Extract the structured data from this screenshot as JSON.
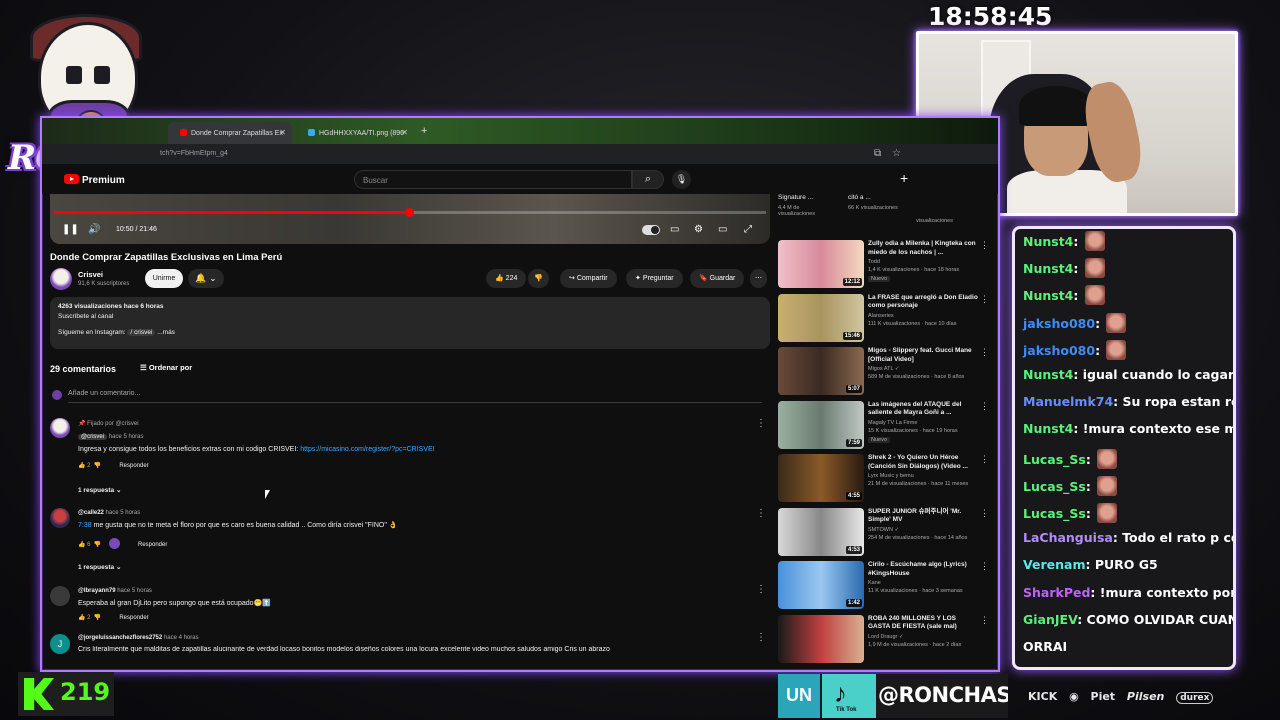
{
  "clock": "18:58:45",
  "logo": {
    "text": "RONCHAS"
  },
  "browser": {
    "tabs": [
      {
        "title": "Donde Comprar Zapatillas Ex"
      },
      {
        "title": "HGdHHXXYAA/TI.png (896"
      }
    ],
    "url": "tch?v=FbHmEtpm_g4"
  },
  "youtube": {
    "brand": "Premium",
    "search_placeholder": "Buscar",
    "player": {
      "time": "10:50 / 21:46",
      "progress_fraction": 0.498
    },
    "video_title": "Donde Comprar Zapatillas Exclusivas en Lima Perú",
    "channel": {
      "name": "Crisvei",
      "subscribers": "91,6 K suscriptores",
      "join_label": "Unirme"
    },
    "actions": {
      "likes": "224",
      "share": "Compartir",
      "ask": "Preguntar",
      "save": "Guardar"
    },
    "description": {
      "stats": "4263 visualizaciones  hace 6 horas",
      "line1": "Suscríbete al canal",
      "line2": "Sígueme en Instagram:",
      "handle": "/ crisvei",
      "more": "...más"
    },
    "comments_header": {
      "count": "29 comentarios",
      "sort": "Ordenar por",
      "add_placeholder": "Añade un comentario..."
    },
    "comments": [
      {
        "pinned": "Fijado por @crisvei",
        "author": "@crisvei",
        "time": "hace 5 horas",
        "text": "Ingresa y consigue todos los beneficios extras con mi codigo CRISVEI:",
        "link": "https://micasino.com/register/?pc=CRISVEI",
        "likes": "2",
        "reply": "Responder",
        "replies": "1 respuesta"
      },
      {
        "author": "@calle22",
        "time": "hace 5 horas",
        "timestamp_link": "7:38",
        "text": "me gusta que no te meta el floro por que es caro es buena calidad .. Como diría crisvei  \"FINO\" 👌",
        "likes": "6",
        "reply": "Responder",
        "replies": "1 respuesta"
      },
      {
        "author": "@lbrayann79",
        "time": "hace 5 horas",
        "text": "Esperaba al gran DjLito pero supongo que está ocupado😁⬆️",
        "likes": "2",
        "reply": "Responder"
      },
      {
        "author": "@jorgeluissanchezflores2752",
        "time": "hace 4 horas",
        "text": "Cris literalmente que malditas de zapatillas alucinante de verdad locaso bonitos modelos diseños colores una locura excelente video muchos saludos amigo Cris un abrazo"
      }
    ],
    "top_cards": [
      {
        "title": "Signature ...",
        "views": "4,4 M de visualizaciones"
      },
      {
        "title": "citó a ...",
        "views": "66 K visualizaciones"
      },
      {
        "title": "",
        "views": "visualizaciones"
      }
    ],
    "sidebar": [
      {
        "title": "Zully odia a Milenka | Kingteka con miedo de los nachos | ...",
        "channel": "Todd",
        "meta": "1,4 K visualizaciones · hace 18 horas",
        "badge": "Nuevo",
        "duration": "12:12"
      },
      {
        "title": "La FRASE que arregló a Don Eladio como personaje",
        "channel": "Alanseries",
        "meta": "111 K visualizaciones · hace 10 días",
        "badge": "",
        "duration": "15:46"
      },
      {
        "title": "Migos - Slippery feat. Gucci Mane [Official Video]",
        "channel": "Migos ATL ✓",
        "meta": "589 M de visualizaciones · hace 8 años",
        "badge": "",
        "duration": "5:07"
      },
      {
        "title": "Las imágenes del ATAQUE del saliente de Mayra Goñi a ...",
        "channel": "Magaly TV La Firme",
        "meta": "15 K visualizaciones · hace 19 horas",
        "badge": "Nuevo",
        "duration": "7:59"
      },
      {
        "title": "Shrek 2 - Yo Quiero Un Héroe (Canción Sin Diálogos) (Video ...",
        "channel": "Lyrx Music y bemu",
        "meta": "21 M de visualizaciones · hace 11 meses",
        "badge": "",
        "duration": "4:55"
      },
      {
        "title": "SUPER JUNIOR 슈퍼주니어 'Mr. Simple' MV",
        "channel": "SMTOWN ✓",
        "meta": "254 M de visualizaciones · hace 14 años",
        "badge": "",
        "duration": "4:53"
      },
      {
        "title": "Cirilo - Escúchame algo (Lyrics) #KingsHouse",
        "channel": "Kane",
        "meta": "11 K visualizaciones · hace 3 semanas",
        "badge": "",
        "duration": "1:42"
      },
      {
        "title": "ROBA 240 MILLONES Y LOS GASTA DE FIESTA (sale mal)",
        "channel": "Lord Draugr ✓",
        "meta": "1,9 M de visualizaciones · hace 2 días",
        "badge": "",
        "duration": ""
      }
    ]
  },
  "chat": [
    {
      "user": "Nunst4",
      "color": "#5cf07a",
      "text": "",
      "emote": true
    },
    {
      "user": "Nunst4",
      "color": "#5cf07a",
      "text": "",
      "emote": true
    },
    {
      "user": "Nunst4",
      "color": "#5cf07a",
      "text": "",
      "emote": true
    },
    {
      "user": "jaksho080",
      "color": "#3c8cff",
      "text": "",
      "emote": true
    },
    {
      "user": "jaksho080",
      "color": "#3c8cff",
      "text": "",
      "emote": true
    },
    {
      "user": "Nunst4",
      "color": "#5cf07a",
      "text": "igual cuando lo cagaron a",
      "emote": false
    },
    {
      "user": "Manuelmk74",
      "color": "#6a8cff",
      "text": "Su ropa estan reman",
      "emote": false
    },
    {
      "user": "Nunst4",
      "color": "#5cf07a",
      "text": "!mura contexto ese mensa",
      "emote": false
    },
    {
      "user": "Lucas_Ss",
      "color": "#5cf07a",
      "text": "",
      "emote": true
    },
    {
      "user": "Lucas_Ss",
      "color": "#5cf07a",
      "text": "",
      "emote": true
    },
    {
      "user": "Lucas_Ss",
      "color": "#5cf07a",
      "text": "",
      "emote": true
    },
    {
      "user": "LaChanguisa",
      "color": "#b08cff",
      "text": "Todo el rato p con el",
      "emote": false
    },
    {
      "user": "Verenam",
      "color": "#5ce8e8",
      "text": "PURO G5",
      "emote": false
    },
    {
      "user": "SharkPed",
      "color": "#c060ff",
      "text": "!mura contexto porque r",
      "emote": false
    },
    {
      "user": "GianJEV",
      "color": "#5cf07a",
      "text": "COMO OLVIDAR CUANDO",
      "emote": false
    },
    {
      "user": "",
      "color": "#ffffff",
      "text": "ORRAI",
      "emote": false
    }
  ],
  "overlay": {
    "kick_viewers": "219",
    "tiktok_left": "UN",
    "tiktok_label": "Tik Tok",
    "tiktok_handle": "@RONCHAS_I",
    "sponsors": [
      "KICK",
      "Piet",
      "Pilsen",
      "durex"
    ]
  },
  "colors": {
    "accent": "#9a5cff",
    "kick": "#53fc18",
    "yt_red": "#ff0000",
    "link": "#3ea6ff"
  }
}
